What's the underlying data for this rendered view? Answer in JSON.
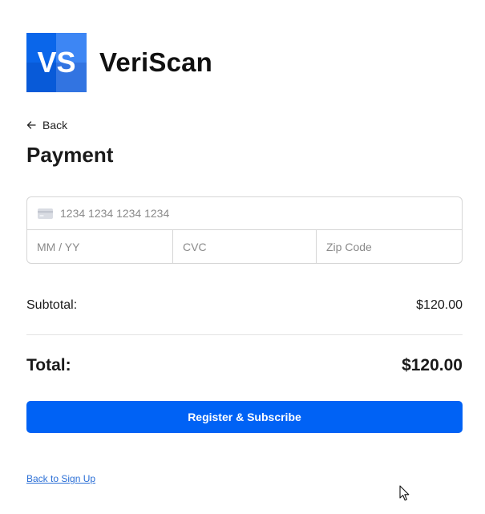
{
  "brand": {
    "logo_letters": "VS",
    "name": "VeriScan",
    "primary_color": "#0062f5"
  },
  "nav": {
    "back_label": "Back"
  },
  "page": {
    "title": "Payment"
  },
  "card_form": {
    "card_number_placeholder": "1234 1234 1234 1234",
    "expiry_placeholder": "MM / YY",
    "cvc_placeholder": "CVC",
    "zip_placeholder": "Zip Code",
    "card_icon": "credit-card-icon"
  },
  "summary": {
    "subtotal_label": "Subtotal:",
    "subtotal_value": "$120.00",
    "total_label": "Total:",
    "total_value": "$120.00"
  },
  "actions": {
    "submit_label": "Register & Subscribe",
    "back_to_signup_label": "Back to Sign Up"
  }
}
